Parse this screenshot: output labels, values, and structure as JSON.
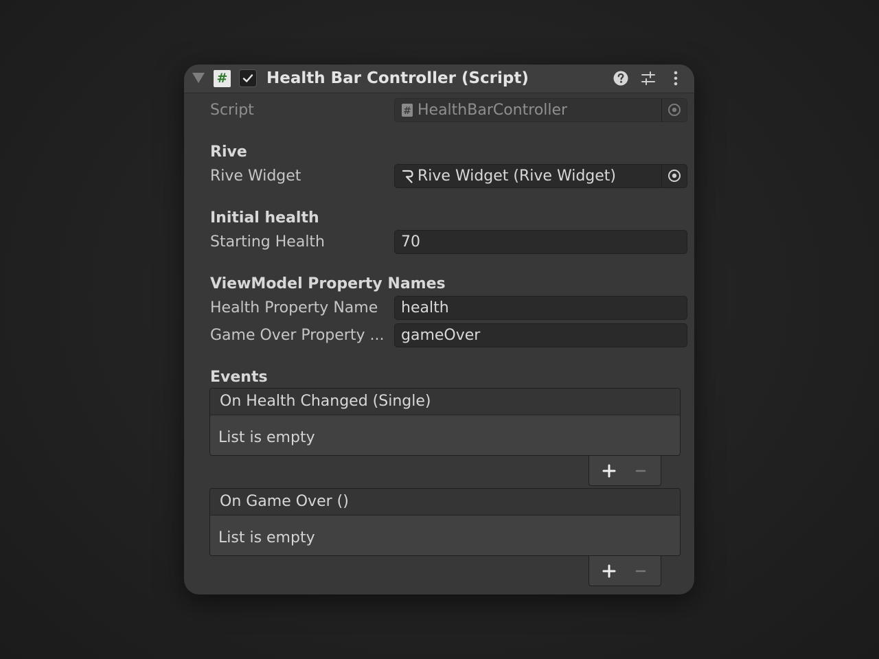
{
  "component": {
    "title": "Health Bar Controller (Script)",
    "enabled": true,
    "script_icon_glyph": "#",
    "icons": [
      "foldout-arrow-icon",
      "csharp-script-icon",
      "checkmark-icon",
      "help-icon",
      "presets-icon",
      "kebab-menu-icon"
    ]
  },
  "script_row": {
    "label": "Script",
    "value": "HealthBarController"
  },
  "rive_section": {
    "title": "Rive",
    "widget_label": "Rive Widget",
    "widget_value": "Rive Widget (Rive Widget)"
  },
  "health_section": {
    "title": "Initial health",
    "starting_label": "Starting Health",
    "starting_value": "70"
  },
  "viewmodel_section": {
    "title": "ViewModel Property Names",
    "health_prop_label": "Health Property Name",
    "health_prop_value": "health",
    "gameover_prop_label": "Game Over Property ...",
    "gameover_prop_value": "gameOver"
  },
  "events_section": {
    "title": "Events",
    "events": [
      {
        "name": "On Health Changed (Single)",
        "empty_text": "List is empty"
      },
      {
        "name": "On Game Over ()",
        "empty_text": "List is empty"
      }
    ]
  },
  "colors": {
    "background": "#1e1e1e",
    "panel": "#383838",
    "field": "#2a2a2a",
    "script_icon_green": "#2f7a2f"
  }
}
